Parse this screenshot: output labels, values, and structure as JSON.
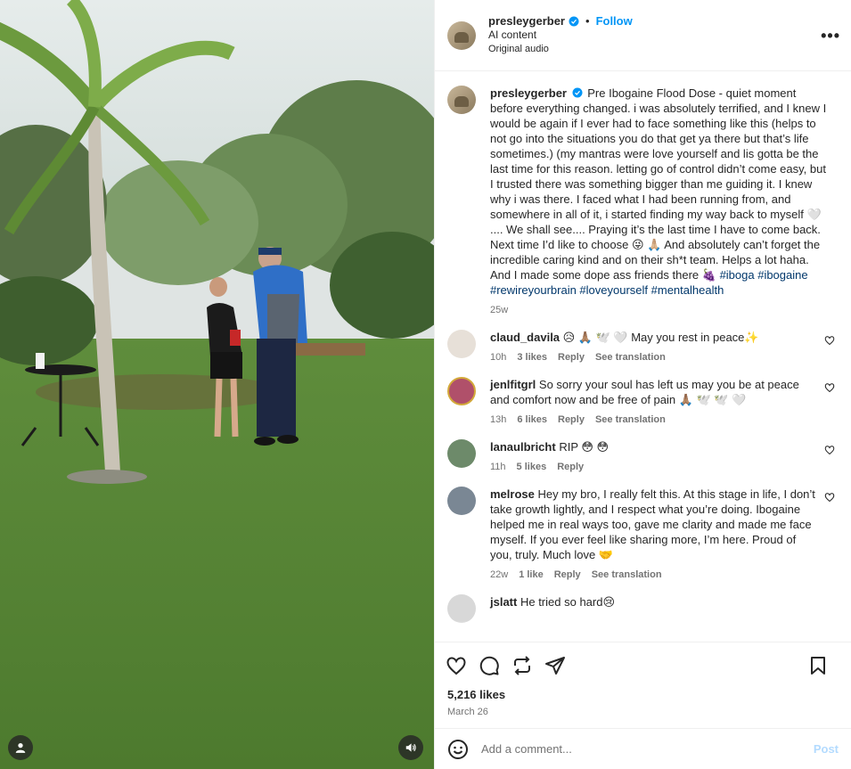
{
  "post": {
    "username": "presleygerber",
    "follow_label": "Follow",
    "separator": "•",
    "subtitle": "AI content",
    "audio": "Original audio",
    "more_label": "•••"
  },
  "caption": {
    "username": "presleygerber",
    "text": "Pre Ibogaine Flood Dose - quiet moment before everything changed. i was absolutely terrified, and I knew I would be again if I ever had to face something like this (helps to not go into the situations you do that get ya there but that’s life sometimes.) (my mantras were love yourself and lis gotta be the last time for this reason. letting go of control didn’t come easy, but I trusted there was something bigger than me guiding it. I knew why i was there. I faced what I had been running from, and somewhere in all of it, i started finding my way back to myself 🤍 .... We shall see.... Praying it’s the last time I have to come back. Next time I’d like to choose 😜 🙏🏼 And absolutely can’t forget the incredible caring kind and on their sh*t team. Helps a lot haha. And I made some dope ass friends there 🍇",
    "hashtags": "#iboga #ibogaine #rewireyourbrain #loveyourself #mentalhealth",
    "time": "25w"
  },
  "comments": [
    {
      "user": "claud_davila",
      "text": "😥 🙏🏽 🕊️ 🤍  May you rest in peace✨",
      "time": "10h",
      "likes": "3 likes",
      "reply": "Reply",
      "translate": "See translation",
      "avatar_color": "#e7e0d8"
    },
    {
      "user": "jenlfitgrl",
      "text": "So sorry your soul has left us may you be at peace and comfort now and be free of pain 🙏🏽 🕊️ 🕊️ 🤍",
      "time": "13h",
      "likes": "6 likes",
      "reply": "Reply",
      "translate": "See translation",
      "avatar_color": "#b0506a"
    },
    {
      "user": "lanaulbricht",
      "text": "RIP 😳 😳",
      "time": "11h",
      "likes": "5 likes",
      "reply": "Reply",
      "translate": "",
      "avatar_color": "#6d8a6a"
    },
    {
      "user": "melrose",
      "text": "Hey my bro, I really felt this. At this stage in life, I don’t take growth lightly, and I respect what you’re doing. Ibogaine helped me in real ways too, gave me clarity and made me face myself. If you ever feel like sharing more, I’m here. Proud of you, truly. Much love 🤝",
      "time": "22w",
      "likes": "1 like",
      "reply": "Reply",
      "translate": "See translation",
      "avatar_color": "#7a8794"
    },
    {
      "user": "jslatt",
      "text": "He tried so hard😢",
      "time": "",
      "likes": "",
      "reply": "",
      "translate": "",
      "avatar_color": "#d8d8d8"
    }
  ],
  "likes": "5,216 likes",
  "date": "March 26",
  "comment_input": {
    "placeholder": "Add a comment...",
    "post_label": "Post"
  },
  "colors": {
    "accent": "#0095f6",
    "link": "#00376b",
    "muted": "#737373",
    "post_disabled": "#b3dbff"
  },
  "icons": [
    "heart-icon",
    "comment-icon",
    "share-icon",
    "send-icon",
    "bookmark-icon",
    "emoji-icon",
    "user-tag-icon",
    "audio-icon",
    "verified-icon",
    "more-icon"
  ]
}
